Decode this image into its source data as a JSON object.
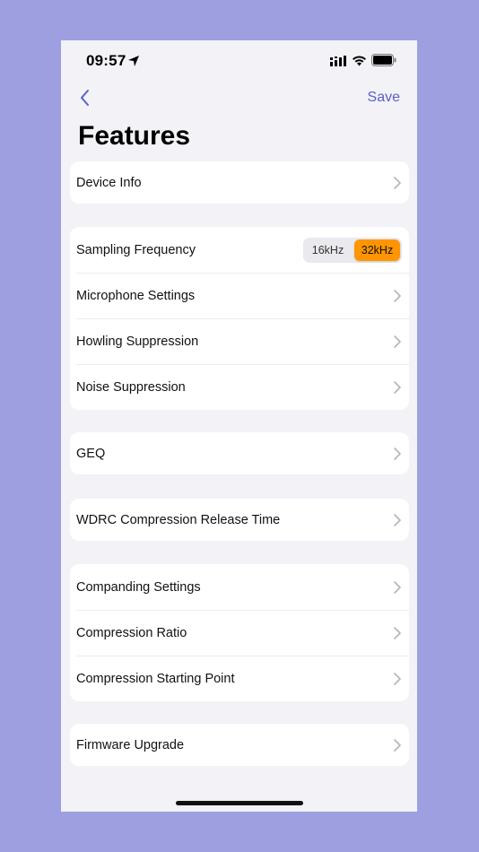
{
  "status_bar": {
    "time": "09:57"
  },
  "nav": {
    "save_label": "Save"
  },
  "page": {
    "title": "Features"
  },
  "groups": {
    "device": {
      "device_info": "Device Info"
    },
    "audio": {
      "sampling_frequency": "Sampling Frequency",
      "sampling_options": [
        "16kHz",
        "32kHz"
      ],
      "sampling_selected": "32kHz",
      "microphone_settings": "Microphone Settings",
      "howling_suppression": "Howling Suppression",
      "noise_suppression": "Noise Suppression"
    },
    "geq": {
      "geq": "GEQ"
    },
    "wdrc": {
      "release_time": "WDRC Compression Release Time"
    },
    "compression": {
      "companding_settings": "Companding Settings",
      "compression_ratio": "Compression Ratio",
      "compression_starting_point": "Compression Starting Point"
    },
    "firmware": {
      "firmware_upgrade": "Firmware Upgrade"
    }
  },
  "colors": {
    "accent": "#5b5fc7",
    "segment_active": "#ff9500",
    "page_background": "#f2f2f7",
    "outer_background": "#9e9fe0"
  }
}
